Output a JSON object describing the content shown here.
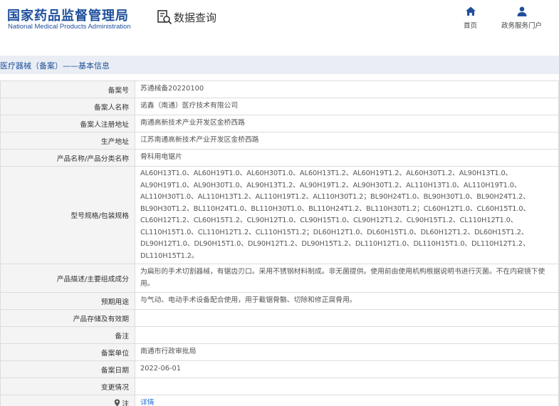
{
  "header": {
    "brand_cn": "国家药品监督管理局",
    "brand_en": "National Medical Products Administration",
    "query_label": "数据查询",
    "nav": {
      "home": "首页",
      "portal": "政务服务门户"
    }
  },
  "breadcrumb": "医疗器械（备案）——基本信息",
  "record": {
    "rows": [
      {
        "label": "备案号",
        "value": "苏通械备20220100"
      },
      {
        "label": "备案人名称",
        "value": "诺鑫（南通）医疗技术有限公司"
      },
      {
        "label": "备案人注册地址",
        "value": "南通高新技术产业开发区金桥西路"
      },
      {
        "label": "生产地址",
        "value": "江苏南通高新技术产业开发区金桥西路"
      },
      {
        "label": "产品名称/产品分类名称",
        "value": "骨科用电锯片"
      },
      {
        "label": "型号规格/包装规格",
        "value": "AL60H13T1.0、AL60H19T1.0、AL60H30T1.0、AL60H13T1.2、AL60H19T1.2、AL60H30T1.2、AL90H13T1.0、AL90H19T1.0、AL90H30T1.0、AL90H13T1.2、AL90H19T1.2、AL90H30T1.2、AL110H13T1.0、AL110H19T1.0、AL110H30T1.0、AL110H13T1.2、AL110H19T1.2、AL110H30T1.2；BL90H24T1.0、BL90H30T1.0、BL90H24T1.2、BL90H30T1.2、BL110H24T1.0、BL110H30T1.0、BL110H24T1.2、BL110H30T1.2；CL60H12T1.0、CL60H15T1.0、CL60H12T1.2、CL60H15T1.2、CL90H12T1.0、CL90H15T1.0、CL90H12T1.2、CL90H15T1.2、CL110H12T1.0、CL110H15T1.0、CL110H12T1.2、CL110H15T1.2；DL60H12T1.0、DL60H15T1.0、DL60H12T1.2、DL60H15T1.2、DL90H12T1.0、DL90H15T1.0、DL90H12T1.2、DL90H15T1.2、DL110H12T1.0、DL110H15T1.0、DL110H12T1.2、DL110H15T1.2。"
      },
      {
        "label": "产品描述/主要组成成分",
        "value": "为扁形的手术切割器械，有锯齿刃口。采用不锈钢材料制成。非无菌提供。使用前由使用机构根据说明书进行灭菌。不在内窥镜下使用。"
      },
      {
        "label": "预期用途",
        "value": "与气动、电动手术设备配合使用，用于截锯骨骼、切除和修正腐骨用。"
      },
      {
        "label": "产品存储及有效期",
        "value": ""
      },
      {
        "label": "备注",
        "value": ""
      },
      {
        "label": "备案单位",
        "value": "南通市行政审批局"
      },
      {
        "label": "备案日期",
        "value": "2022-06-01"
      },
      {
        "label": "变更情况",
        "value": ""
      },
      {
        "label": "注",
        "value": "详情"
      }
    ]
  },
  "colors": {
    "brand": "#1f4f9c",
    "link": "#1f6fd6",
    "label_bg": "#f4f4f4",
    "crumb_bg": "#eaeef4"
  },
  "icons": {
    "query": "search-document-icon",
    "home": "home-icon",
    "portal": "user-icon",
    "note": "location-pin-icon"
  }
}
